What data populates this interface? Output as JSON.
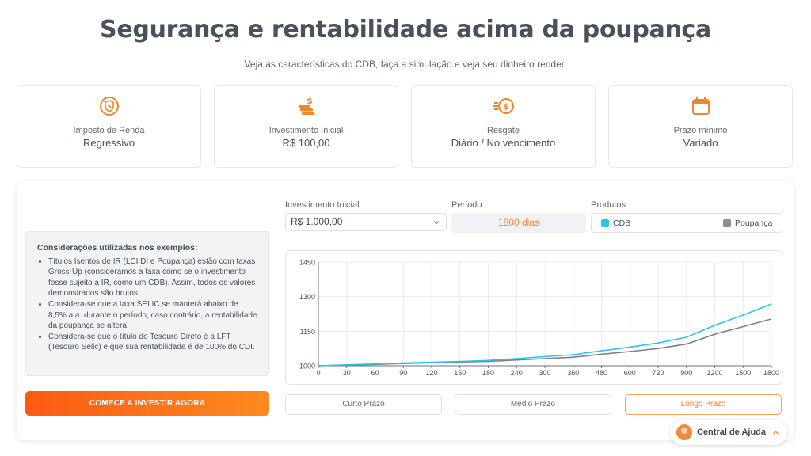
{
  "header": {
    "title": "Segurança e rentabilidade acima da poupança",
    "subtitle": "Veja as características do CDB, faça a simulação e veja seu dinheiro render."
  },
  "cards": [
    {
      "icon": "shield-money-icon",
      "label": "Imposto de Renda",
      "value": "Regressivo"
    },
    {
      "icon": "coins-icon",
      "label": "Investimento Inicial",
      "value": "R$ 100,00"
    },
    {
      "icon": "cash-back-icon",
      "label": "Resgate",
      "value": "Diário / No vencimento"
    },
    {
      "icon": "calendar-icon",
      "label": "Prazo mínimo",
      "value": "Variado"
    }
  ],
  "considerations": {
    "title": "Considerações utilizadas nos exemplos:",
    "items": [
      "Títulos Isentos de IR (LCI DI e Poupança) estão com taxas Gross-Up (consideramos a taxa como se o investimento fosse sujeito a IR, como um CDB). Assim, todos os valores demonstrados são brutos.",
      "Considera-se que a taxa SELIC se manterá abaixo de 8,5% a.a. durante o período, caso contrário, a rentabilidade da poupança se altera.",
      "Considera-se que o título do Tesouro Direto é a LFT (Tesouro Selic) e que sua rentabilidade é de 100% do CDI."
    ]
  },
  "cta_label": "COMECE A INVESTIR AGORA",
  "form": {
    "investment_label": "Investimento Inicial",
    "investment_value": "R$ 1.000,00",
    "period_label": "Período",
    "period_value": "1800 dias",
    "products_label": "Produtos",
    "products": [
      {
        "name": "CDB",
        "color": "#29c5ec"
      },
      {
        "name": "Poupança",
        "color": "#8a8e96"
      }
    ]
  },
  "chart_data": {
    "type": "line",
    "categories": [
      "0",
      "30",
      "60",
      "90",
      "120",
      "150",
      "180",
      "240",
      "300",
      "360",
      "480",
      "600",
      "720",
      "900",
      "1200",
      "1500",
      "1800"
    ],
    "yticks": [
      "1000",
      "1150",
      "1300",
      "1450"
    ],
    "ylim": [
      1000,
      1450
    ],
    "grid": true,
    "series": [
      {
        "name": "CDB",
        "color": "#29c5ec",
        "values": [
          1000,
          1004,
          1008,
          1012,
          1015,
          1019,
          1023,
          1031,
          1040,
          1048,
          1065,
          1081,
          1099,
          1124,
          1176,
          1220,
          1268
        ]
      },
      {
        "name": "Poupança",
        "color": "#7c8088",
        "values": [
          1000,
          1003,
          1006,
          1010,
          1013,
          1016,
          1019,
          1025,
          1031,
          1037,
          1050,
          1062,
          1075,
          1094,
          1137,
          1170,
          1203
        ]
      }
    ]
  },
  "tabs": [
    {
      "label": "Curto Prazo",
      "active": false
    },
    {
      "label": "Médio Prazo",
      "active": false
    },
    {
      "label": "Longo Prazo",
      "active": true
    }
  ],
  "help_label": "Central de Ajuda"
}
